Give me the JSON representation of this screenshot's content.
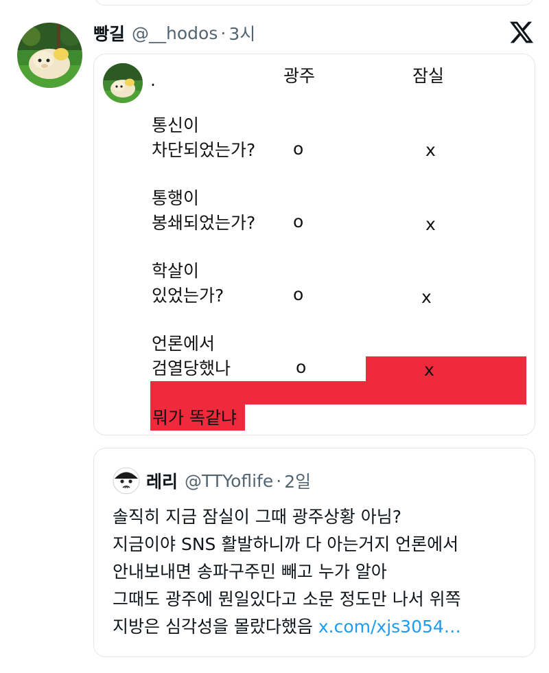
{
  "tweet": {
    "author_name": "빵길",
    "author_handle": "@__hodos",
    "separator": "·",
    "time": "3시",
    "platform_icon": "x-logo-icon"
  },
  "image": {
    "dot": ".",
    "columns": [
      "광주",
      "잠실"
    ],
    "rows": [
      {
        "question_line1": "통신이",
        "question_line2": "차단되었는가?",
        "gwangju": "o",
        "jamsil": "x"
      },
      {
        "question_line1": "통행이",
        "question_line2": "봉쇄되었는가?",
        "gwangju": "o",
        "jamsil": "x"
      },
      {
        "question_line1": "학살이",
        "question_line2": "있었는가?",
        "gwangju": "o",
        "jamsil": "x"
      },
      {
        "question_line1": "언론에서",
        "question_line2": "검열당했나",
        "gwangju": "o",
        "jamsil": "x"
      }
    ],
    "caption": "뭐가 똑같냐",
    "highlight_color": "#ee2a3c"
  },
  "quote": {
    "author_name": "레리",
    "author_handle": "@TTYoflife",
    "separator": "·",
    "time": "2일",
    "lines": [
      "솔직히 지금 잠실이 그때 광주상황 아님?",
      "지금이야 SNS 활발하니까 다 아는거지 언론에서",
      "안내보내면 송파구주민 빼고 누가 알아",
      "그때도 광주에 뭔일있다고 소문 정도만 나서 위쪽"
    ],
    "last_line_text": "지방은 심각성을 몰랐다했음",
    "link_text": "x.com/xjs3054…",
    "link_color": "#1d9bf0"
  }
}
